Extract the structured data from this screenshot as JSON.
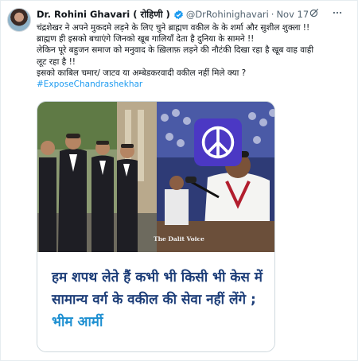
{
  "tweet": {
    "author_name": "Dr. Rohini Ghavari ( रोहिणी )",
    "handle": "@DrRohinighavari",
    "separator": "·",
    "timestamp": "Nov 17",
    "text_lines": [
      "चंद्रशेखर ने अपने मुकदमे लड़ने के लिए चुने ब्राह्मण वकील के के शर्मा और सुशील शुक्ला !!",
      "ब्राह्मण ही इसको बचाएंगे जिनको खूब गालियाँ देता है दुनिया के सामने !!",
      "लेकिन पूरे बहुजन समाज को मनुवाद के ख़िलाफ़ लड़ने की नौटंकी दिखा रहा है खूब वाह वाही",
      "लूट रहा है !!",
      "इसको काबिल चमार/ जाटव या अम्बेडकरवादी वकील नहीं मिले क्या ?"
    ],
    "hashtag": "#ExposeChandrashekhar"
  },
  "media": {
    "caption_main": "हम शपथ लेते हैं कभी भी किसी भी केस में सामान्य वर्ग के वकील की सेवा नहीं लेंगे ;",
    "caption_brand": "भीम आर्मी",
    "watermark": "The Dalit Voice"
  },
  "colors": {
    "link": "#1d9bf0",
    "verified": "#1d9bf0",
    "caption_text": "#1c3d78",
    "caption_brand": "#1d8fd1",
    "peace_badge": "#4b38c4"
  },
  "icons": [
    "verified-badge-icon",
    "grok-icon",
    "more-icon",
    "peace-sign-icon"
  ]
}
